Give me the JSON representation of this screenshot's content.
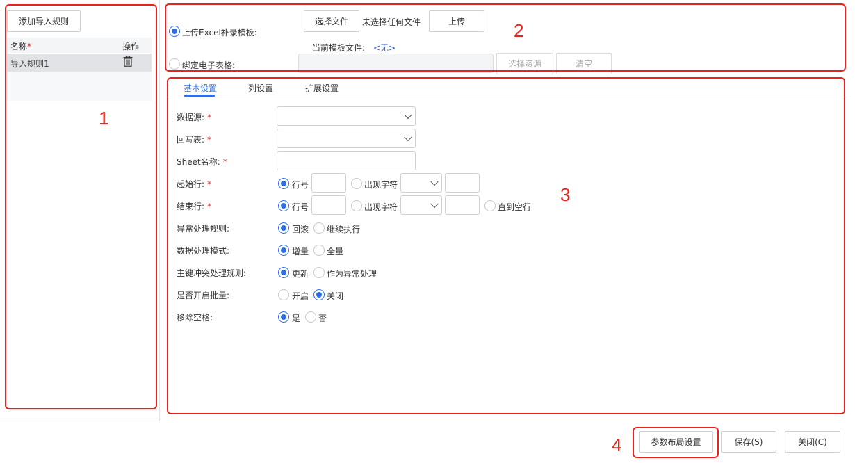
{
  "left_panel": {
    "add_button": "添加导入规则",
    "headers": {
      "name": "名称",
      "required_mark": "*",
      "action": "操作"
    },
    "rules": [
      {
        "name": "导入规则1"
      }
    ]
  },
  "upload": {
    "upload_option_label": "上传Excel补录模板:",
    "choose_file": "选择文件",
    "no_file": "未选择任何文件",
    "upload_button": "上传",
    "current_template_label": "当前模板文件:",
    "current_template_value": "<无>",
    "bind_option_label": "绑定电子表格:",
    "select_resource": "选择资源",
    "clear": "清空"
  },
  "tabs": [
    {
      "label": "基本设置",
      "active": true
    },
    {
      "label": "列设置",
      "active": false
    },
    {
      "label": "扩展设置",
      "active": false
    }
  ],
  "form": {
    "required_mark": "*",
    "datasource_label": "数据源:",
    "writeback_label": "回写表:",
    "sheet_label": "Sheet名称:",
    "start_row_label": "起始行:",
    "end_row_label": "结束行:",
    "row_no": "行号",
    "char_appear": "出现字符",
    "until_empty": "直到空行",
    "error_rule_label": "异常处理规则:",
    "rollback": "回滚",
    "continue": "继续执行",
    "data_mode_label": "数据处理模式:",
    "increment": "增量",
    "full": "全量",
    "key_conflict_label": "主键冲突处理规则:",
    "update": "更新",
    "as_error": "作为异常处理",
    "batch_label": "是否开启批量:",
    "on": "开启",
    "off": "关闭",
    "trim_label": "移除空格:",
    "yes": "是",
    "no": "否"
  },
  "footer": {
    "layout_button": "参数布局设置",
    "save_button": "保存(S)",
    "close_button": "关闭(C)"
  },
  "annotations": [
    "1",
    "2",
    "3",
    "4"
  ]
}
